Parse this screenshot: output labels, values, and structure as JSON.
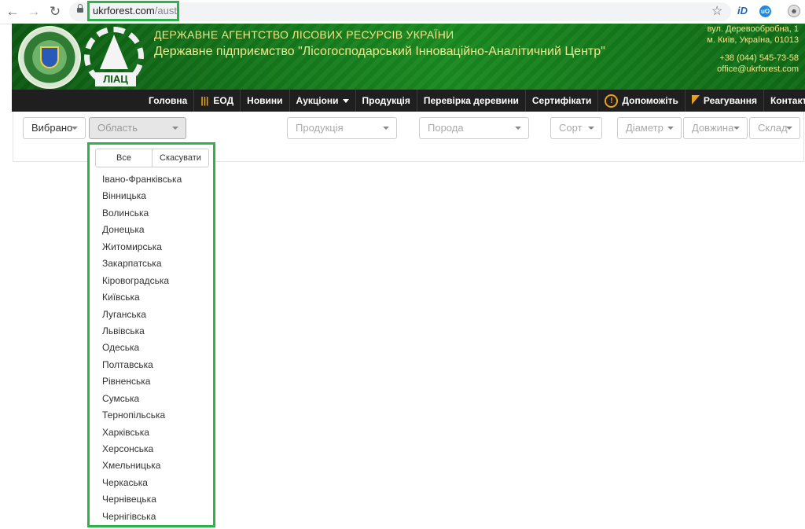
{
  "browser": {
    "url_host": "ukrforest.com",
    "url_path": "/austat"
  },
  "header": {
    "agency": "ДЕРЖАВНЕ АГЕНТСТВО ЛІСОВИХ РЕСУРСІВ УКРАЇНИ",
    "enterprise": "Державне підприємство \"Лісогосподарський Інноваційно-Аналітичний Центр\"",
    "address_line1": "вул. Деревообробна, 1",
    "address_line2": "м. Київ, Україна, 01013",
    "phone": "+38 (044) 545-73-58",
    "email": "office@ukrforest.com",
    "logo_text": "ЛІАЦ"
  },
  "nav": {
    "items": [
      "Головна",
      "ЕОД",
      "Новини",
      "Аукціони",
      "Продукція",
      "Перевірка деревини",
      "Сертифікати",
      "Допоможіть",
      "Реагування",
      "Контакти"
    ]
  },
  "filters": {
    "selected": "Вибрано ",
    "region": "Область",
    "product": "Продукція",
    "species": "Порода",
    "grade": "Сорт",
    "diameter": "Діаметр",
    "length": "Довжина",
    "warehouse": "Склад"
  },
  "dropdown": {
    "select_all": "Все",
    "cancel": "Скасувати",
    "regions": [
      "Івано-Франківська",
      "Вінницька",
      "Волинська",
      "Донецька",
      "Житомирська",
      "Закарпатська",
      "Кіровоградська",
      "Київська",
      "Луганська",
      "Львівська",
      "Одеська",
      "Полтавська",
      "Рівненська",
      "Сумська",
      "Тернопільська",
      "Харківська",
      "Херсонська",
      "Хмельницька",
      "Черкаська",
      "Чернівецька",
      "Чернігівська"
    ]
  },
  "colors": {
    "highlight": "#2cb34a",
    "header_green": "#157a1c",
    "nav_bg": "#1f1f1f",
    "accent": "#e6a21b"
  }
}
